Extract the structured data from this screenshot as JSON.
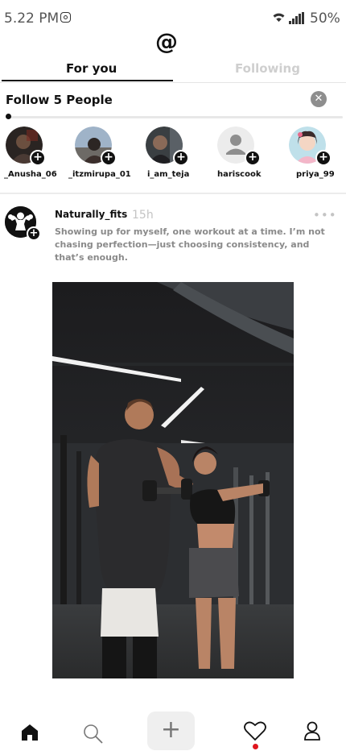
{
  "status_bar": {
    "time": "5.22 PM",
    "battery": "50%",
    "icons": [
      "instagram-icon",
      "wifi-icon",
      "signal-icon"
    ]
  },
  "header": {
    "logo_icon": "threads-logo-icon"
  },
  "tabs": [
    {
      "label": "For you",
      "active": true
    },
    {
      "label": "Following",
      "active": false
    }
  ],
  "suggestions": {
    "title": "Follow 5 People",
    "progress_fraction": 0.0,
    "people": [
      {
        "username": "_Anusha_06"
      },
      {
        "username": "_itzmirupa_01"
      },
      {
        "username": "i_am_teja"
      },
      {
        "username": "hariscook"
      },
      {
        "username": "priya_99"
      }
    ]
  },
  "post": {
    "username": "Naturally_fits",
    "time": "15h",
    "text": "Showing up for myself, one workout at a time. I’m not chasing perfection—just choosing consistency, and that’s enough.",
    "image_icon": "gym-photo"
  },
  "bottom_nav": {
    "items": [
      "home-icon",
      "search-icon",
      "create-icon",
      "heart-icon",
      "profile-icon"
    ],
    "create_symbol": "+",
    "activity_badge_color": "#e0161e"
  },
  "colors": {
    "accent": "#111111",
    "muted": "#8a8a8a",
    "inactive_tab": "#cfcfcf"
  }
}
